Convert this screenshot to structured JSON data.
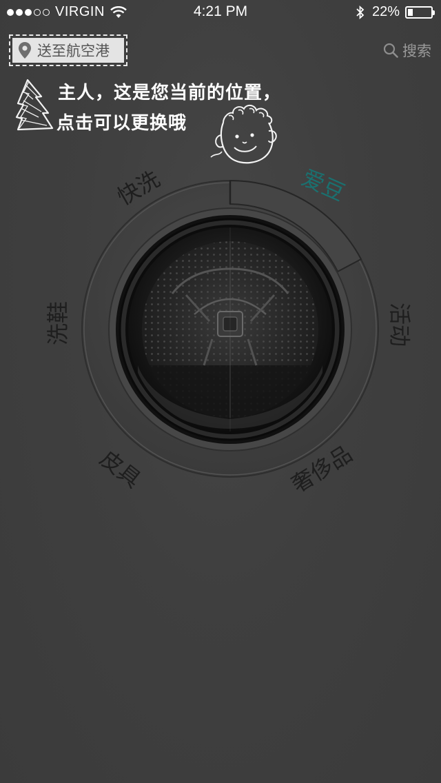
{
  "status_bar": {
    "carrier": "VIRGIN",
    "time": "4:21 PM",
    "battery_percent_text": "22%",
    "battery_level": 0.22,
    "signal_bars_filled": 3,
    "signal_bars_total": 5
  },
  "header": {
    "location_text": "送至航空港",
    "search_label": "搜索"
  },
  "hint": {
    "line1": "主人，这是您当前的位置，",
    "line2": "点击可以更换哦"
  },
  "dial": {
    "items": [
      {
        "label": "快洗",
        "active": false
      },
      {
        "label": "爱豆",
        "active": true
      },
      {
        "label": "活动",
        "active": false
      },
      {
        "label": "奢侈品",
        "active": false
      },
      {
        "label": "皮具",
        "active": false
      },
      {
        "label": "洗鞋",
        "active": false
      }
    ]
  },
  "colors": {
    "background": "#3e3e3e",
    "active_label": "#1a7170",
    "inactive_label": "#1e1e1e",
    "location_pill": "#e4e4e4"
  }
}
